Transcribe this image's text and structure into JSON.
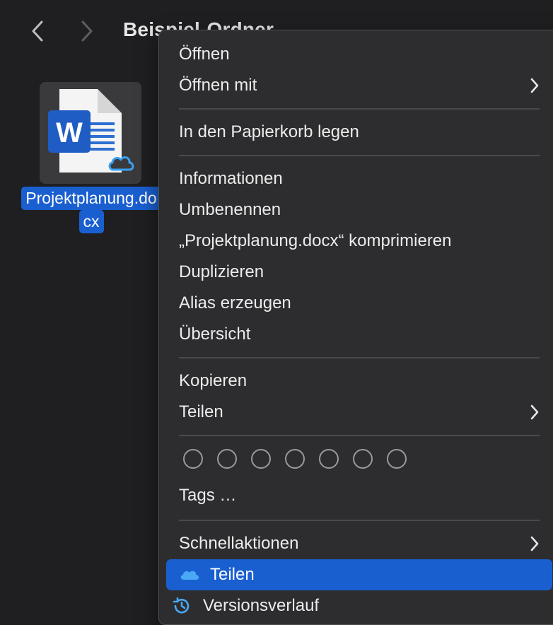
{
  "window": {
    "folder_title": "Beispiel-Ordner"
  },
  "file": {
    "name_line1": "Projektplanung.do",
    "name_line2": "cx",
    "icon": "word-document-icon",
    "badge": "onedrive-cloud-icon"
  },
  "menu": {
    "open": "Öffnen",
    "open_with": "Öffnen mit",
    "trash": "In den Papierkorb legen",
    "info": "Informationen",
    "rename": "Umbenennen",
    "compress": "„Projektplanung.docx“ komprimieren",
    "duplicate": "Duplizieren",
    "alias": "Alias erzeugen",
    "quicklook": "Übersicht",
    "copy": "Kopieren",
    "share": "Teilen",
    "tags": "Tags …",
    "quick_actions": "Schnellaktionen",
    "onedrive_share": "Teilen",
    "version_history": "Versionsverlauf"
  },
  "colors": {
    "background": "#1f1f21",
    "menu_bg": "#2d2d2f",
    "highlight": "#1a5fd0",
    "word_blue": "#1f5cc4"
  }
}
